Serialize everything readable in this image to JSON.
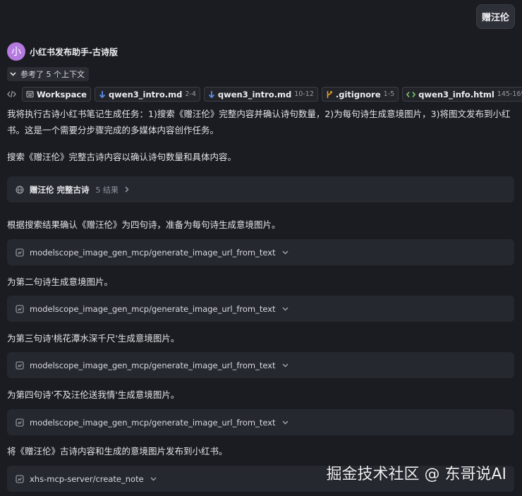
{
  "user_message": "赠汪伦",
  "assistant": {
    "avatar_char": "小",
    "name": "小红书发布助手-古诗版"
  },
  "context": {
    "label": "参考了 5 个上下文"
  },
  "refs": [
    {
      "name": "Workspace",
      "range": "",
      "icon": "folder-icon"
    },
    {
      "name": "qwen3_intro.md",
      "range": "2-4",
      "icon": "markdown-icon"
    },
    {
      "name": "qwen3_intro.md",
      "range": "10-12",
      "icon": "markdown-icon"
    },
    {
      "name": ".gitignore",
      "range": "1-5",
      "icon": "git-icon"
    },
    {
      "name": "qwen3_info.html",
      "range": "145-169",
      "icon": "html-icon"
    }
  ],
  "paragraphs": [
    "我将执行古诗小红书笔记生成任务：1)搜索《赠汪伦》完整内容并确认诗句数量，2)为每句诗生成意境图片，3)将图文发布到小红书。这是一个需要分步骤完成的多媒体内容创作任务。",
    "搜索《赠汪伦》完整古诗内容以确认诗句数量和具体内容。",
    "根据搜索结果确认《赠汪伦》为四句诗，准备为每句诗生成意境图片。",
    "为第二句诗生成意境图片。",
    "为第三句诗'桃花潭水深千尺'生成意境图片。",
    "为第四句诗'不及汪伦送我情'生成意境图片。",
    "将《赠汪伦》古诗内容和生成的意境图片发布到小红书。"
  ],
  "search": {
    "title": "赠汪伦 完整古诗",
    "count": "5 结果"
  },
  "tool_calls": [
    "modelscope_image_gen_mcp/generate_image_url_from_text",
    "modelscope_image_gen_mcp/generate_image_url_from_text",
    "modelscope_image_gen_mcp/generate_image_url_from_text",
    "modelscope_image_gen_mcp/generate_image_url_from_text",
    "xhs-mcp-server/create_note"
  ],
  "watermark": "掘金技术社区 @ 东哥说AI",
  "colors": {
    "avatar": "#b47ae0",
    "md_icon": "#5a8de8",
    "git_icon": "#e5a02b",
    "html_icon": "#7bc96f"
  }
}
